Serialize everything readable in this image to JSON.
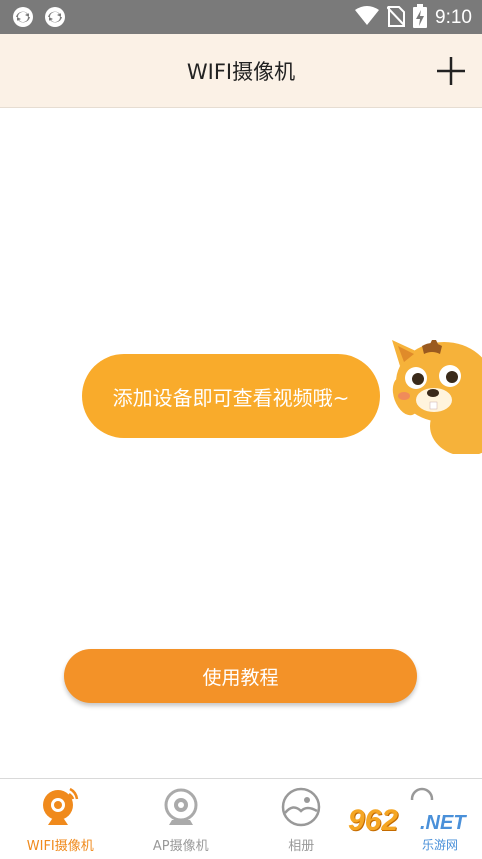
{
  "status_bar": {
    "time": "9:10",
    "left_icons": [
      "sync-icon",
      "sync-icon"
    ],
    "right_icons": [
      "wifi-icon",
      "no-sim-icon",
      "battery-charging-icon"
    ]
  },
  "header": {
    "title": "WIFI摄像机",
    "add_icon": "plus-icon"
  },
  "empty_state": {
    "message": "添加设备即可查看视频哦~",
    "mascot": "cat-mascot"
  },
  "tutorial_button": {
    "label": "使用教程"
  },
  "bottom_nav": {
    "items": [
      {
        "label": "WIFI摄像机",
        "icon": "webcam-icon",
        "active": true
      },
      {
        "label": "AP摄像机",
        "icon": "camera-icon",
        "active": false
      },
      {
        "label": "相册",
        "icon": "album-icon",
        "active": false
      },
      {
        "label": "",
        "icon": "profile-icon",
        "active": false
      }
    ]
  },
  "watermark": {
    "number": "962",
    "suffix": ".NET",
    "subtitle": "乐游网"
  },
  "colors": {
    "header_bg": "#fbf1e6",
    "accent": "#f39228",
    "bubble": "#f9ab2b",
    "status_bar": "#7a7a7a",
    "inactive": "#999999"
  }
}
